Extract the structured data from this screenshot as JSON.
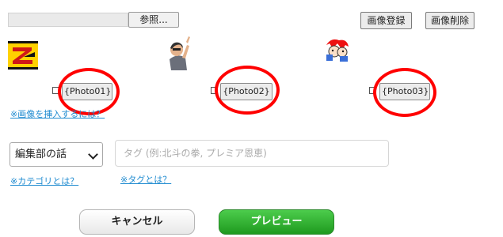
{
  "upload": {
    "file_value": "",
    "browse_label": "参照...",
    "register_label": "画像登録",
    "delete_label": "画像削除"
  },
  "photos": [
    {
      "label": "{Photo01}",
      "checked": false
    },
    {
      "label": "{Photo02}",
      "checked": false
    },
    {
      "label": "{Photo03}",
      "checked": false
    }
  ],
  "links": {
    "insert_help": "※画像を挿入するには？",
    "category_help": "※カテゴリとは？",
    "tag_help": "※タグとは？"
  },
  "category": {
    "selected": "編集部の話"
  },
  "tag": {
    "placeholder": "タグ (例:北斗の拳, プレミア恩恵)",
    "value": ""
  },
  "actions": {
    "cancel_label": "キャンセル",
    "preview_label": "プレビュー"
  },
  "colors": {
    "accent_link": "#1f8bd0",
    "highlight_ring": "#ff0000",
    "preview_green": "#2aaa2a"
  },
  "icons": [
    "z-logo-thumbnail",
    "man-pointing-thumbnail",
    "cartoon-character-thumbnail",
    "chevron-down-icon"
  ]
}
